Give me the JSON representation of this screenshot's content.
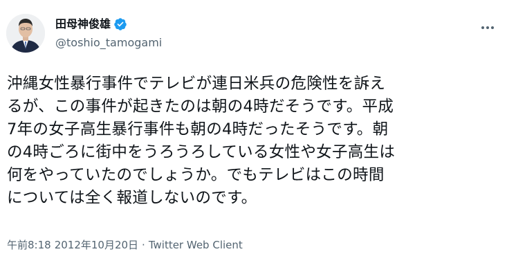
{
  "author": {
    "display_name": "田母神俊雄",
    "handle": "@toshio_tamogami",
    "verified": true,
    "verified_color": "#1d9bf0"
  },
  "tweet": {
    "lines": [
      "沖縄女性暴行事件でテレビが連日米兵の危険性を訴え",
      "るが、この事件が起きたのは朝の4時だそうです。平成",
      "7年の女子高生暴行事件も朝の4時だったそうです。朝",
      "の4時ごろに街中をうろうろしている女性や女子高生は",
      "何をやっていたのでしょうか。でもテレビはこの時間",
      "については全く報道しないのです。"
    ]
  },
  "meta": {
    "time": "午前8:18",
    "separator": "·",
    "date": "2012年10月20日",
    "client": "Twitter Web Client"
  },
  "icons": {
    "more": "more-options-icon",
    "verified": "verified-badge-icon"
  }
}
